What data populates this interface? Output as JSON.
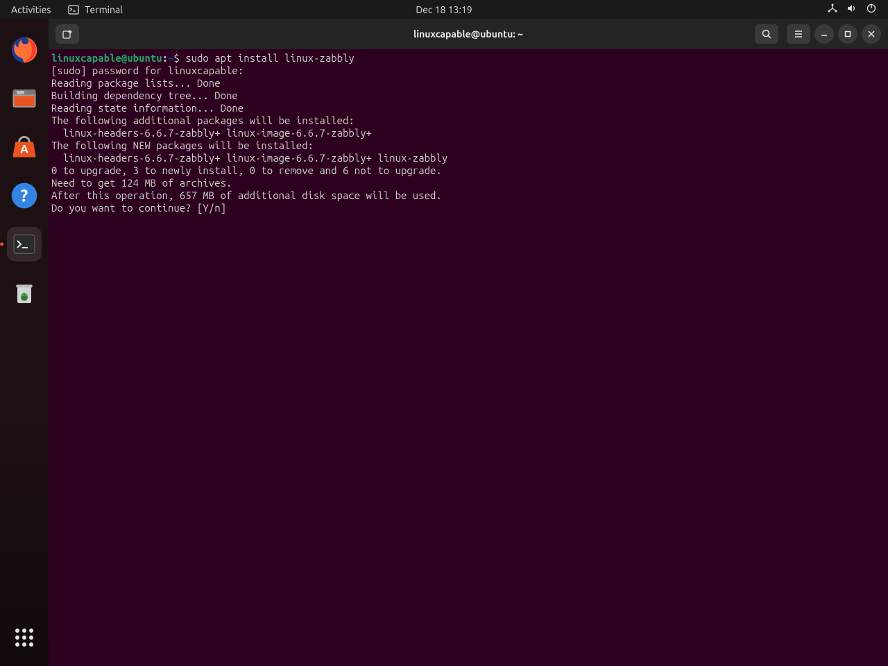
{
  "topbar": {
    "activities": "Activities",
    "app_name": "Terminal",
    "datetime": "Dec 18  13:19"
  },
  "dock": {
    "items": [
      "firefox",
      "files",
      "software",
      "help",
      "terminal",
      "trash"
    ],
    "active": "terminal"
  },
  "window": {
    "title": "linuxcapable@ubuntu: ~"
  },
  "terminal": {
    "prompt_user": "linuxcapable@ubuntu",
    "prompt_sep": ":",
    "prompt_path": "~",
    "prompt_sym": "$ ",
    "command": "sudo apt install linux-zabbly",
    "lines": [
      "[sudo] password for linuxcapable: ",
      "Reading package lists... Done",
      "Building dependency tree... Done",
      "Reading state information... Done",
      "The following additional packages will be installed:",
      "  linux-headers-6.6.7-zabbly+ linux-image-6.6.7-zabbly+",
      "The following NEW packages will be installed:",
      "  linux-headers-6.6.7-zabbly+ linux-image-6.6.7-zabbly+ linux-zabbly",
      "0 to upgrade, 3 to newly install, 0 to remove and 6 not to upgrade.",
      "Need to get 124 MB of archives.",
      "After this operation, 657 MB of additional disk space will be used.",
      "Do you want to continue? [Y/n] "
    ]
  }
}
